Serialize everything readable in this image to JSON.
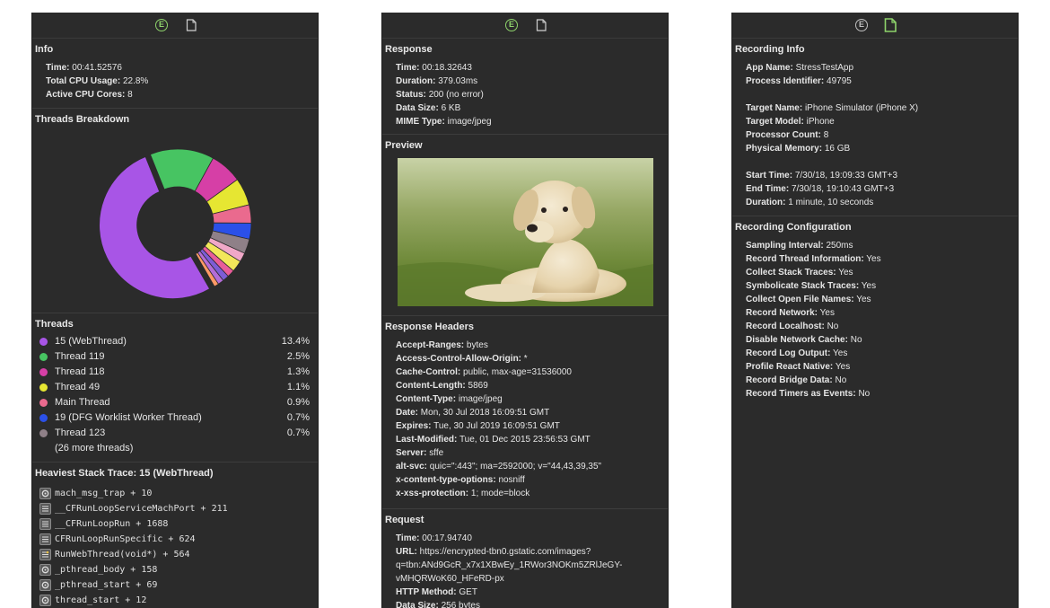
{
  "panel1": {
    "info": {
      "title": "Info",
      "time_label": "Time:",
      "time_value": "00:41.52576",
      "cpu_label": "Total CPU Usage:",
      "cpu_value": "22.8%",
      "cores_label": "Active CPU Cores:",
      "cores_value": "8"
    },
    "threads_breakdown_title": "Threads Breakdown",
    "threads": {
      "title": "Threads",
      "items": [
        {
          "name": "15 (WebThread)",
          "pct": "13.4%",
          "color": "#a855e6"
        },
        {
          "name": "Thread 119",
          "pct": "2.5%",
          "color": "#47c462"
        },
        {
          "name": "Thread 118",
          "pct": "1.3%",
          "color": "#d63fa6"
        },
        {
          "name": "Thread 49",
          "pct": "1.1%",
          "color": "#e6e632"
        },
        {
          "name": "Main Thread",
          "pct": "0.9%",
          "color": "#ea6a8e"
        },
        {
          "name": "19 (DFG Worklist Worker Thread)",
          "pct": "0.7%",
          "color": "#2b50e8"
        },
        {
          "name": "Thread 123",
          "pct": "0.7%",
          "color": "#8f8088"
        }
      ],
      "more": "(26 more threads)"
    },
    "stack": {
      "title": "Heaviest Stack Trace: 15 (WebThread)",
      "frames": [
        {
          "text": "mach_msg_trap + 10",
          "icon": "gear-icon"
        },
        {
          "text": "__CFRunLoopServiceMachPort + 211",
          "icon": "list-icon"
        },
        {
          "text": "__CFRunLoopRun + 1688",
          "icon": "list-icon"
        },
        {
          "text": "CFRunLoopRunSpecific + 624",
          "icon": "list-icon"
        },
        {
          "text": "RunWebThread(void*) + 564",
          "icon": "webkit-icon"
        },
        {
          "text": "_pthread_body + 158",
          "icon": "gear-icon"
        },
        {
          "text": "_pthread_start + 69",
          "icon": "gear-icon"
        },
        {
          "text": "thread_start + 12",
          "icon": "gear-icon"
        }
      ]
    }
  },
  "panel2": {
    "response": {
      "title": "Response",
      "rows": [
        {
          "k": "Time:",
          "v": "00:18.32643"
        },
        {
          "k": "Duration:",
          "v": "379.03ms"
        },
        {
          "k": "Status:",
          "v": "200 (no error)"
        },
        {
          "k": "Data Size:",
          "v": "6 KB"
        },
        {
          "k": "MIME Type:",
          "v": "image/jpeg"
        }
      ]
    },
    "preview_title": "Preview",
    "headers": {
      "title": "Response Headers",
      "rows": [
        {
          "k": "Accept-Ranges:",
          "v": "bytes"
        },
        {
          "k": "Access-Control-Allow-Origin:",
          "v": "*"
        },
        {
          "k": "Cache-Control:",
          "v": "public, max-age=31536000"
        },
        {
          "k": "Content-Length:",
          "v": "5869"
        },
        {
          "k": "Content-Type:",
          "v": "image/jpeg"
        },
        {
          "k": "Date:",
          "v": "Mon, 30 Jul 2018 16:09:51 GMT"
        },
        {
          "k": "Expires:",
          "v": "Tue, 30 Jul 2019 16:09:51 GMT"
        },
        {
          "k": "Last-Modified:",
          "v": "Tue, 01 Dec 2015 23:56:53 GMT"
        },
        {
          "k": "Server:",
          "v": "sffe"
        },
        {
          "k": "alt-svc:",
          "v": "quic=\":443\"; ma=2592000; v=\"44,43,39,35\""
        },
        {
          "k": "x-content-type-options:",
          "v": "nosniff"
        },
        {
          "k": "x-xss-protection:",
          "v": "1; mode=block"
        }
      ]
    },
    "request": {
      "title": "Request",
      "time_label": "Time:",
      "time_value": "00:17.94740",
      "url_label": "URL:",
      "url_line1": "https://encrypted-tbn0.gstatic.com/images?",
      "url_line2": "q=tbn:ANd9GcR_x7x1XBwEy_1RWor3NOKm5ZRlJeGY-",
      "url_line3": "vMHQRWoK60_HFeRD-px",
      "method_label": "HTTP Method:",
      "method_value": "GET",
      "size_label": "Data Size:",
      "size_value": "256 bytes"
    }
  },
  "panel3": {
    "recording_info": {
      "title": "Recording Info",
      "group1": [
        {
          "k": "App Name:",
          "v": "StressTestApp"
        },
        {
          "k": "Process Identifier:",
          "v": "49795"
        }
      ],
      "group2": [
        {
          "k": "Target Name:",
          "v": "iPhone Simulator (iPhone X)"
        },
        {
          "k": "Target Model:",
          "v": "iPhone"
        },
        {
          "k": "Processor Count:",
          "v": "8"
        },
        {
          "k": "Physical Memory:",
          "v": "16 GB"
        }
      ],
      "group3": [
        {
          "k": "Start Time:",
          "v": "7/30/18, 19:09:33 GMT+3"
        },
        {
          "k": "End Time:",
          "v": "7/30/18, 19:10:43 GMT+3"
        },
        {
          "k": "Duration:",
          "v": "1 minute, 10 seconds"
        }
      ]
    },
    "recording_config": {
      "title": "Recording Configuration",
      "rows": [
        {
          "k": "Sampling Interval:",
          "v": "250ms"
        },
        {
          "k": "Record Thread Information:",
          "v": "Yes"
        },
        {
          "k": "Collect Stack Traces:",
          "v": "Yes"
        },
        {
          "k": "Symbolicate Stack Traces:",
          "v": "Yes"
        },
        {
          "k": "Collect Open File Names:",
          "v": "Yes"
        },
        {
          "k": "Record Network:",
          "v": "Yes"
        },
        {
          "k": "Record Localhost:",
          "v": "No"
        },
        {
          "k": "Disable Network Cache:",
          "v": "No"
        },
        {
          "k": "Record Log Output:",
          "v": "Yes"
        },
        {
          "k": "Profile React Native:",
          "v": "Yes"
        },
        {
          "k": "Record Bridge Data:",
          "v": "No"
        },
        {
          "k": "Record Timers as Events:",
          "v": "No"
        }
      ]
    }
  },
  "toolbar": {
    "e_icon_letter": "E"
  },
  "colors": {
    "accent_green": "#8ed36b",
    "panel_bg": "#2b2b2b"
  }
}
